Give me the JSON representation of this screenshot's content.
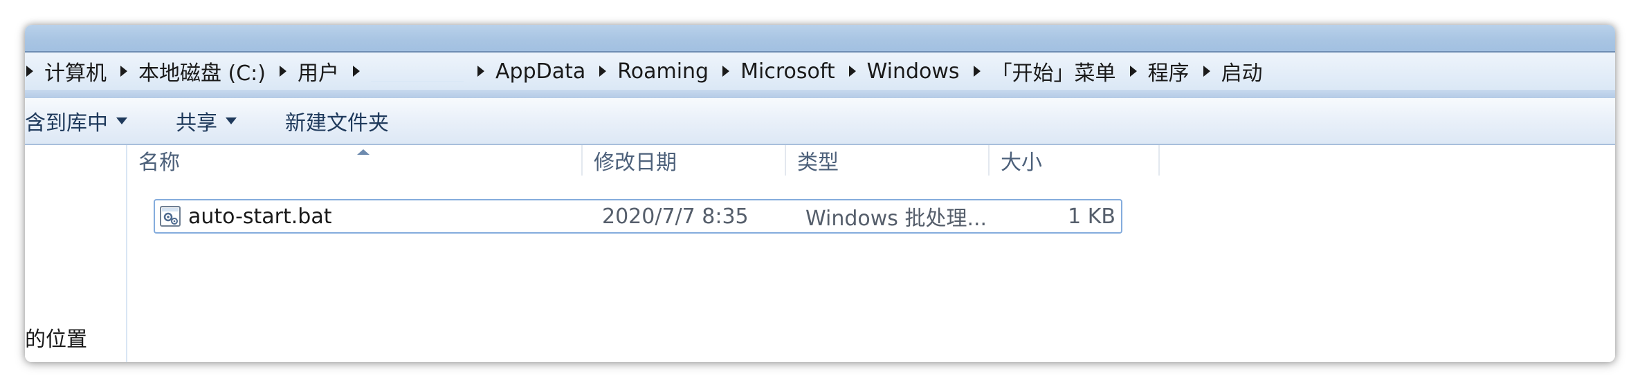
{
  "address": {
    "crumbs": [
      "计算机",
      "本地磁盘 (C:)",
      "用户",
      "",
      "AppData",
      "Roaming",
      "Microsoft",
      "Windows",
      "「开始」菜单",
      "程序",
      "启动"
    ]
  },
  "toolbar": {
    "include_in_library_label": "含到库中",
    "share_label": "共享",
    "new_folder_label": "新建文件夹"
  },
  "nav": {
    "partial_item_label": "的位置"
  },
  "columns": {
    "name": "名称",
    "date_modified": "修改日期",
    "type": "类型",
    "size": "大小"
  },
  "files": [
    {
      "name": "auto-start.bat",
      "date_modified": "2020/7/7 8:35",
      "type": "Windows 批处理...",
      "size": "1 KB",
      "icon": "batch-file-icon"
    }
  ]
}
